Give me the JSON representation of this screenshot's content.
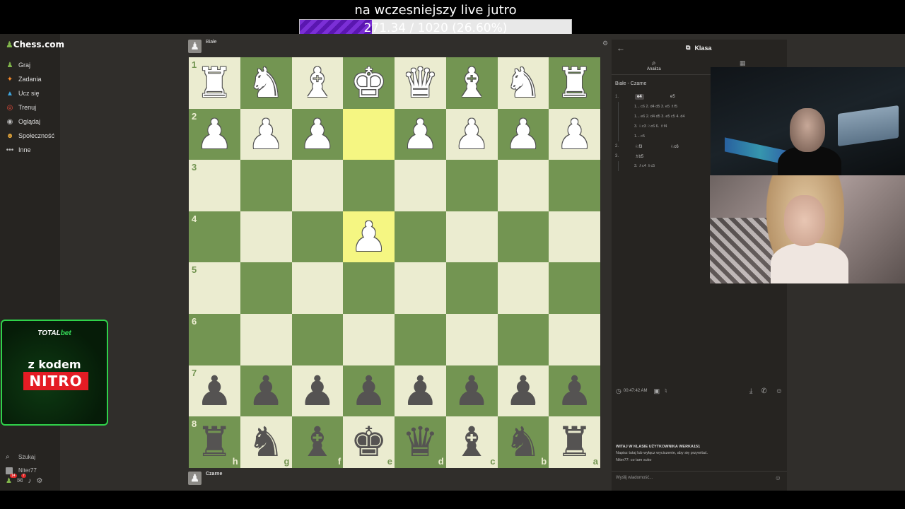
{
  "overlay": {
    "title": "na wczesniejszy live jutro",
    "goal_text": "271.34 / 1020 (26.60%)",
    "goal_fraction": 0.266
  },
  "sidebar": {
    "logo": "Chess.com",
    "items": [
      {
        "label": "Graj",
        "icon": "play-icon"
      },
      {
        "label": "Zadania",
        "icon": "puzzle-icon"
      },
      {
        "label": "Ucz się",
        "icon": "learn-icon"
      },
      {
        "label": "Trenuj",
        "icon": "train-icon"
      },
      {
        "label": "Oglądaj",
        "icon": "watch-icon"
      },
      {
        "label": "Społeczność",
        "icon": "community-icon"
      },
      {
        "label": "Inne",
        "icon": "more-icon"
      }
    ],
    "search": "Szukaj",
    "user": "Niter77",
    "badges": {
      "notifications": "14",
      "messages": "7"
    }
  },
  "ad": {
    "brand_a": "TOTAL",
    "brand_b": "bet",
    "line1": "z kodem",
    "line2": "NITRO"
  },
  "board": {
    "top_player": "Białe",
    "bottom_player": "Czarne",
    "rank_labels": [
      "1",
      "2",
      "3",
      "4",
      "5",
      "6",
      "7",
      "8"
    ],
    "file_labels": [
      "h",
      "g",
      "f",
      "e",
      "d",
      "c",
      "b",
      "a"
    ],
    "rows": [
      [
        "wR",
        "wN",
        "wB",
        "wK",
        "wQ",
        "wB",
        "wN",
        "wR"
      ],
      [
        "wP",
        "wP",
        "wP",
        "",
        "wP",
        "wP",
        "wP",
        "wP"
      ],
      [
        "",
        "",
        "",
        "",
        "",
        "",
        "",
        ""
      ],
      [
        "",
        "",
        "",
        "wP",
        "",
        "",
        "",
        ""
      ],
      [
        "",
        "",
        "",
        "",
        "",
        "",
        "",
        ""
      ],
      [
        "",
        "",
        "",
        "",
        "",
        "",
        "",
        ""
      ],
      [
        "bP",
        "bP",
        "bP",
        "bP",
        "bP",
        "bP",
        "bP",
        "bP"
      ],
      [
        "bR",
        "bN",
        "bB",
        "bK",
        "bQ",
        "bB",
        "bN",
        "bR"
      ]
    ],
    "highlights": [
      [
        1,
        3
      ],
      [
        3,
        3
      ]
    ]
  },
  "panel": {
    "title": "Klasa",
    "tab_analysis": "Analiza",
    "players_line": "Białe - Czarne",
    "moves": [
      {
        "n": "1.",
        "w": "e4",
        "b": "e5",
        "highlight": true
      },
      {
        "var": "1... c6  2. d4  d5  3. e5  ♗f5"
      },
      {
        "var": "1... e6  2. d4  d5  3. e5  c5  4. d4"
      },
      {
        "var": "3. ♘c3  ♘c6  6. ♗f4"
      },
      {
        "var": "1... c5"
      },
      {
        "n": "2.",
        "w": "♘f3",
        "b": "♘c6"
      },
      {
        "n": "3.",
        "w": "♗b5",
        "b": ""
      },
      {
        "var": "3. ♗c4  ♗c5"
      }
    ],
    "clock": "00:47:42 AM",
    "chat_welcome": "WITAJ W KLASIE UŻYTKOWNIKA WERKA151",
    "chat_hint": "Napisz tutaj lub wyłącz wyciszenie, aby się przywitać.",
    "chat_msg": "Niter77: co tam suko",
    "chat_placeholder": "Wyślij wiadomość..."
  }
}
